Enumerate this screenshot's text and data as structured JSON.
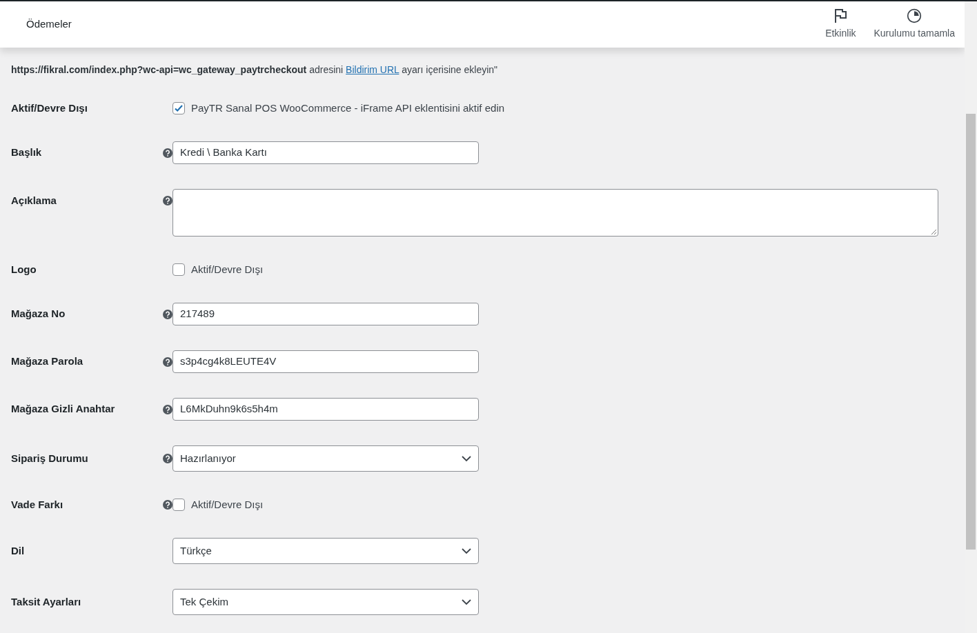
{
  "header": {
    "title": "Ödemeler",
    "actions": [
      {
        "kind": "flag",
        "label": "Etkinlik"
      },
      {
        "kind": "progress",
        "label": "Kurulumu tamamla"
      }
    ]
  },
  "notice": {
    "url": "https://fikral.com/index.php?wc-api=wc_gateway_paytrcheckout",
    "before_link": "adresini",
    "link": "Bildirim URL",
    "after_link": "ayarı içerisine ekleyin\""
  },
  "fields": [
    {
      "kind": "checkbox",
      "label": "Aktif/Devre Dışı",
      "help": false,
      "checked": true,
      "text": "PayTR Sanal POS WooCommerce - iFrame API eklentisini aktif edin"
    },
    {
      "kind": "text",
      "label": "Başlık",
      "help": true,
      "value": "Kredi \\ Banka Kartı"
    },
    {
      "kind": "textarea",
      "label": "Açıklama",
      "help": true
    },
    {
      "kind": "checkbox",
      "label": "Logo",
      "help": false,
      "checked": false,
      "text": "Aktif/Devre Dışı"
    },
    {
      "kind": "text",
      "label": "Mağaza No",
      "help": true,
      "value": "217489"
    },
    {
      "kind": "text",
      "label": "Mağaza Parola",
      "help": true,
      "value": "s3p4cg4k8LEUTE4V"
    },
    {
      "kind": "text",
      "label": "Mağaza Gizli Anahtar",
      "help": true,
      "value": "L6MkDuhn9k6s5h4m"
    },
    {
      "kind": "select",
      "label": "Sipariş Durumu",
      "help": true,
      "value": "Hazırlanıyor"
    },
    {
      "kind": "checkbox",
      "label": "Vade Farkı",
      "help": true,
      "checked": false,
      "text": "Aktif/Devre Dışı"
    },
    {
      "kind": "select",
      "label": "Dil",
      "help": false,
      "value": "Türkçe"
    },
    {
      "kind": "select",
      "label": "Taksit Ayarları",
      "help": false,
      "value": "Tek Çekim"
    }
  ]
}
